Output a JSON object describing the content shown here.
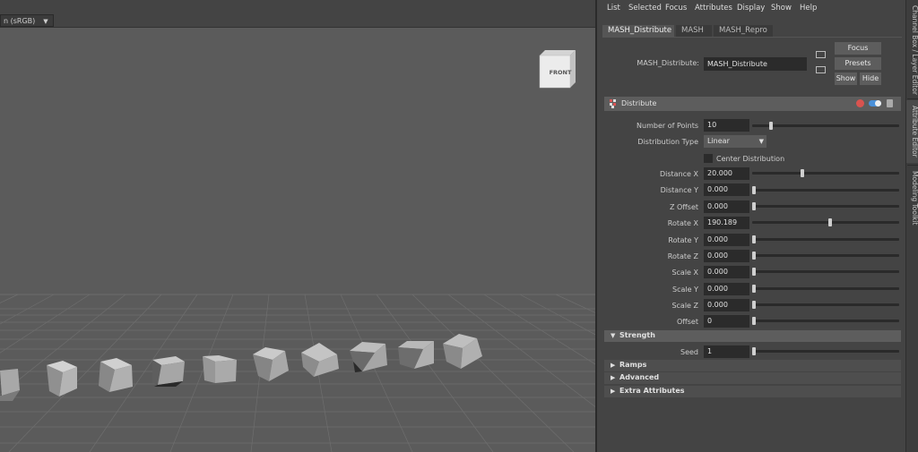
{
  "viewport": {
    "colorspace_label": "n (sRGB)",
    "viewcube_label": "FRONT"
  },
  "menu": [
    "List",
    "Selected",
    "Focus",
    "Attributes",
    "Display",
    "Show",
    "Help"
  ],
  "tabs": [
    "MASH_Distribute",
    "MASH",
    "MASH_Repro"
  ],
  "node": {
    "label": "MASH_Distribute:",
    "value": "MASH_Distribute",
    "focus_button": "Focus",
    "presets_button": "Presets",
    "show_button": "Show",
    "hide_button": "Hide"
  },
  "distribute_section": {
    "title": "Distribute",
    "rows": {
      "number_of_points": {
        "label": "Number of Points",
        "value": "10",
        "slider": 0.12
      },
      "distribution_type": {
        "label": "Distribution Type",
        "value": "Linear"
      },
      "center_distribution": {
        "label": "Center Distribution"
      },
      "distance_x": {
        "label": "Distance X",
        "value": "20.000",
        "slider": 0.34
      },
      "distance_y": {
        "label": "Distance Y",
        "value": "0.000",
        "slider": 0.0
      },
      "z_offset": {
        "label": "Z Offset",
        "value": "0.000",
        "slider": 0.0
      },
      "rotate_x": {
        "label": "Rotate X",
        "value": "190.189",
        "slider": 0.53
      },
      "rotate_y": {
        "label": "Rotate Y",
        "value": "0.000",
        "slider": 0.0
      },
      "rotate_z": {
        "label": "Rotate Z",
        "value": "0.000",
        "slider": 0.0
      },
      "scale_x": {
        "label": "Scale X",
        "value": "0.000",
        "slider": 0.0
      },
      "scale_y": {
        "label": "Scale Y",
        "value": "0.000",
        "slider": 0.0
      },
      "scale_z": {
        "label": "Scale Z",
        "value": "0.000",
        "slider": 0.0
      },
      "offset": {
        "label": "Offset",
        "value": "0",
        "slider": 0.0
      }
    }
  },
  "strength_section": {
    "title": "Strength",
    "seed": {
      "label": "Seed",
      "value": "1",
      "slider": 0.0
    }
  },
  "collapsed_sections": [
    "Ramps",
    "Advanced",
    "Extra Attributes"
  ],
  "side_tabs": [
    "Channel Box / Layer Editor",
    "Attribute Editor",
    "Modeling Toolkit"
  ],
  "colors": {
    "viewport_bg": "#5b5b5b",
    "panel_bg": "#444444",
    "field_bg": "#2b2b2b",
    "section_bg": "#5d5d5d",
    "icon_red": "#d9534f",
    "icon_blue": "#4a90d9"
  },
  "icons": [
    "distribute-node-icon",
    "remove-node-icon",
    "toggle-icon",
    "trash-icon",
    "input-connection-icon",
    "output-connection-icon"
  ]
}
